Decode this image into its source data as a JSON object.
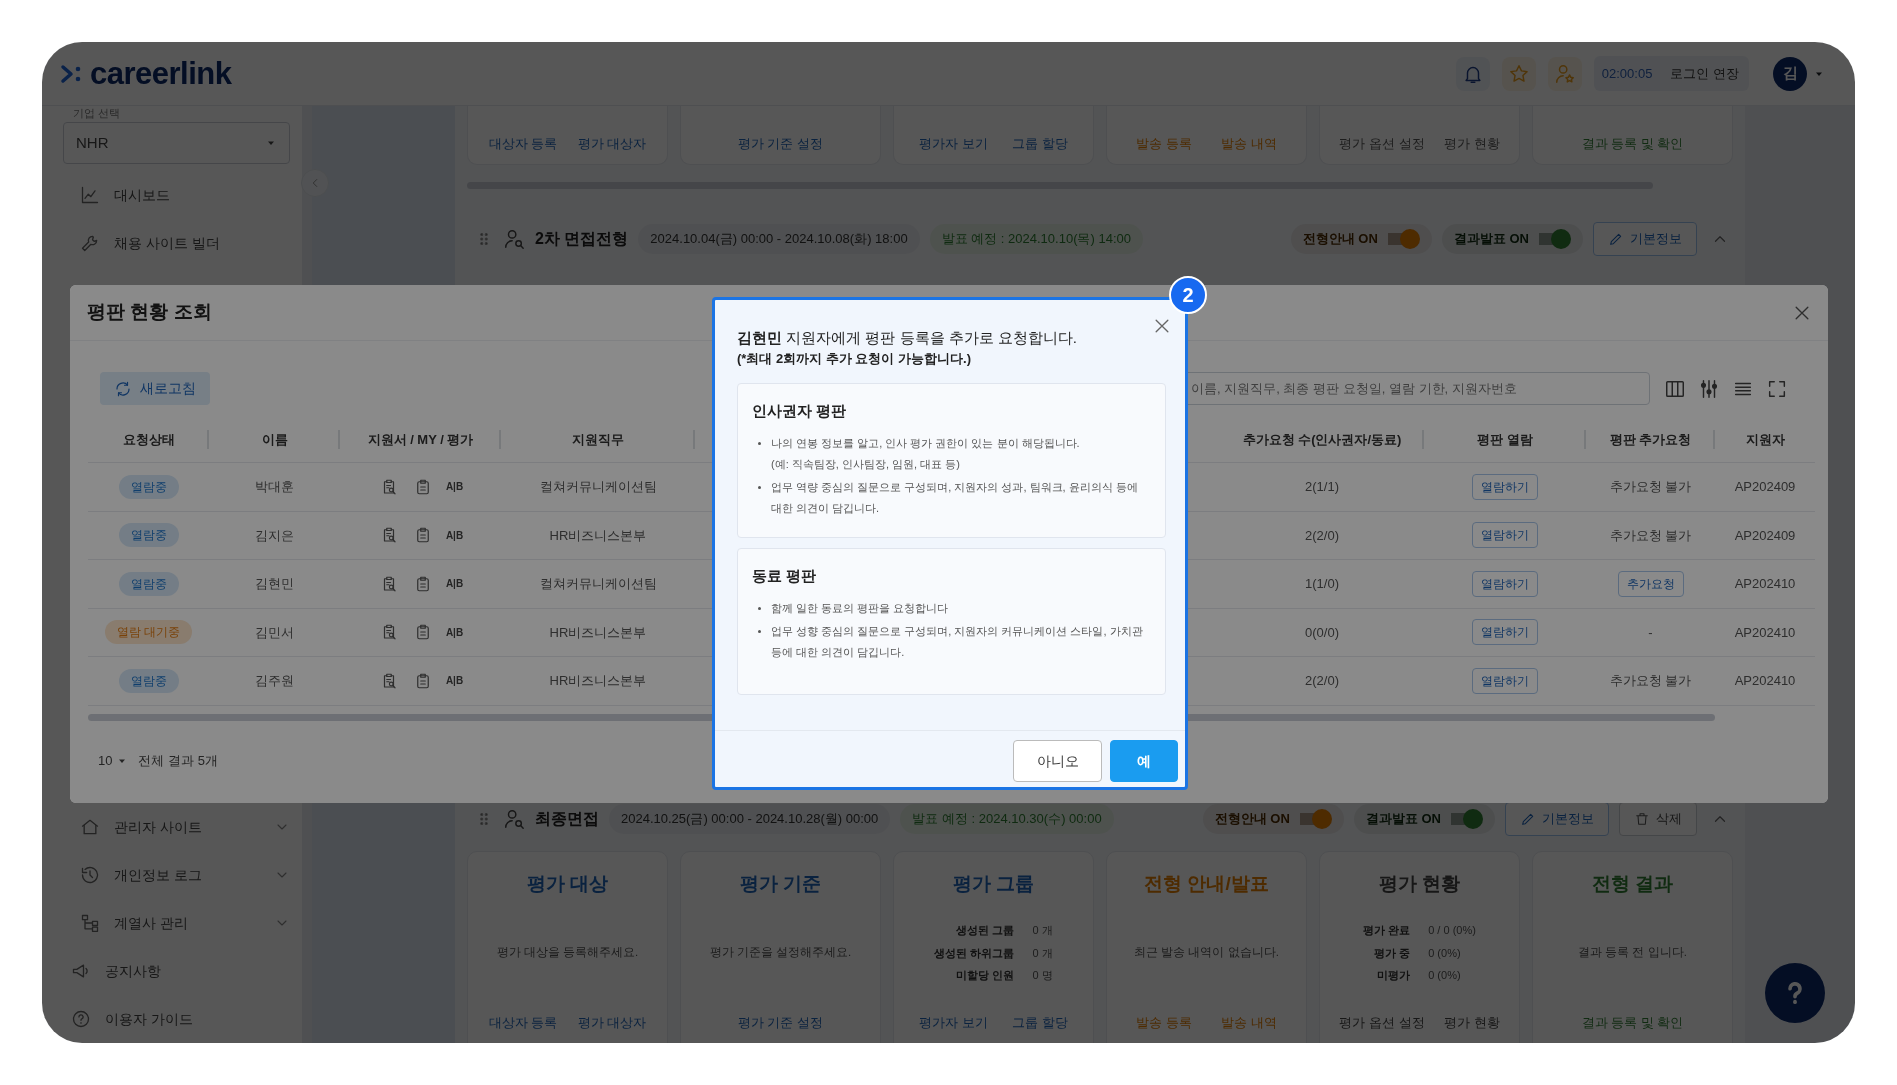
{
  "header": {
    "logo": "careerlink",
    "timer": "02:00:05",
    "extend_login": "로그인 연장",
    "avatar": "김"
  },
  "sidebar": {
    "company_label": "기업 선택",
    "company_value": "NHR",
    "top_items": [
      {
        "label": "대시보드",
        "kind": "link"
      },
      {
        "label": "채용 사이트 빌더",
        "kind": "link"
      }
    ],
    "bottom_items": [
      {
        "label": "관리자 사이트",
        "kind": "group",
        "expanded": false
      },
      {
        "label": "개인정보 로그",
        "kind": "group",
        "expanded": false
      },
      {
        "label": "계열사 관리",
        "kind": "group",
        "expanded": false
      },
      {
        "label": "공지사항",
        "kind": "link"
      },
      {
        "label": "이용자 가이드",
        "kind": "link"
      }
    ]
  },
  "top_strip": [
    {
      "color": "#0a223f",
      "links": [
        "대상자 등록",
        "평가 대상자"
      ]
    },
    {
      "color": "#0a223f",
      "links": [
        "평가 기준 설정"
      ]
    },
    {
      "color": "#0a223f",
      "links": [
        "평가자 보기",
        "그룹 할당"
      ]
    },
    {
      "color": "#4e2b00",
      "links": [
        "발송 등록",
        "발송 내역"
      ]
    },
    {
      "color": "#1d1d1d",
      "links": [
        "평가 옵션 설정",
        "평가 현황"
      ]
    },
    {
      "color": "#102b11",
      "links": [
        "결과 등록 및 확인"
      ]
    }
  ],
  "stages": [
    {
      "title": "2차 면접전형",
      "period": "2024.10.04(금) 00:00 - 2024.10.08(화) 18:00",
      "announce": "발표 예정 : 2024.10.10(목) 14:00",
      "expanded": true,
      "toggles": [
        {
          "label": "전형안내 ON",
          "on": true,
          "color": "#4e2b00"
        },
        {
          "label": "결과발표 ON",
          "on": true,
          "color": "#102b11"
        }
      ],
      "actions": [
        {
          "label": "기본정보",
          "kind": "edit"
        }
      ]
    },
    {
      "title": "최종면접",
      "period": "2024.10.25(금) 00:00 - 2024.10.28(월) 00:00",
      "announce": "발표 예정 : 2024.10.30(수) 00:00",
      "expanded": true,
      "toggles": [
        {
          "label": "전형안내 ON",
          "on": true,
          "color": "#4e2b00"
        },
        {
          "label": "결과발표 ON",
          "on": true,
          "color": "#102b11"
        }
      ],
      "actions": [
        {
          "label": "기본정보",
          "kind": "edit"
        },
        {
          "label": "삭제",
          "kind": "delete"
        }
      ],
      "cards": [
        {
          "title": "평가 대상",
          "color": "#0a223f",
          "kind": "message",
          "message": "평가 대상을 등록해주세요.",
          "links": [
            "대상자 등록",
            "평가 대상자"
          ]
        },
        {
          "title": "평가 기준",
          "color": "#0a223f",
          "kind": "message",
          "message": "평가 기준을 설정해주세요.",
          "links": [
            "평가 기준 설정"
          ]
        },
        {
          "title": "평가 그룹",
          "color": "#0a223f",
          "kind": "stats",
          "stats": [
            {
              "label": "생성된 그룹",
              "value": "0 개"
            },
            {
              "label": "생성된 하위그룹",
              "value": "0 개"
            },
            {
              "label": "미할당 인원",
              "value": "0 명"
            }
          ],
          "links": [
            "평가자 보기",
            "그룹 할당"
          ]
        },
        {
          "title": "전형 안내/발표",
          "color": "#4e2b00",
          "kind": "message",
          "message": "최근 발송 내역이 없습니다.",
          "links": [
            "발송 등록",
            "발송 내역"
          ]
        },
        {
          "title": "평가 현황",
          "color": "#171717",
          "kind": "stats",
          "stats": [
            {
              "label": "평가 완료",
              "value": "0 / 0 (0%)"
            },
            {
              "label": "평가 중",
              "value": "0 (0%)"
            },
            {
              "label": "미평가",
              "value": "0 (0%)"
            }
          ],
          "links": [
            "평가 옵션 설정",
            "평가 현황"
          ]
        },
        {
          "title": "전형 결과",
          "color": "#102b11",
          "kind": "message",
          "message": "결과 등록 전 입니다.",
          "links": [
            "결과 등록 및 확인"
          ]
        }
      ]
    }
  ],
  "panel": {
    "title": "평판 현황 조회",
    "refresh": "새로고침",
    "search_placeholder": "이름, 지원직무, 최종 평판 요청일, 열람 기한, 지원자번호",
    "columns": [
      "요청상태",
      "이름",
      "지원서 / MY / 평가",
      "지원직무",
      "추가요청 수(인사권자/동료)",
      "평판 열람",
      "평판 추가요청",
      "지원자"
    ],
    "rows": [
      {
        "status": {
          "label": "열람중",
          "kind": "viewing"
        },
        "name": "박대훈",
        "eval": "A|B",
        "team": "컬쳐커뮤니케이션팀",
        "count": "2(1/1)",
        "view": "열람하기",
        "extra": {
          "kind": "text",
          "label": "추가요청 불가"
        },
        "applicant_no": "AP202409"
      },
      {
        "status": {
          "label": "열람중",
          "kind": "viewing"
        },
        "name": "김지은",
        "eval": "A|B",
        "team": "HR비즈니스본부",
        "count": "2(2/0)",
        "view": "열람하기",
        "extra": {
          "kind": "text",
          "label": "추가요청 불가"
        },
        "applicant_no": "AP202409"
      },
      {
        "status": {
          "label": "열람중",
          "kind": "viewing"
        },
        "name": "김현민",
        "eval": "A|B",
        "team": "컬쳐커뮤니케이션팀",
        "count": "1(1/0)",
        "view": "열람하기",
        "extra": {
          "kind": "button",
          "label": "추가요청"
        },
        "applicant_no": "AP202410"
      },
      {
        "status": {
          "label": "열람 대기중",
          "kind": "waiting"
        },
        "name": "김민서",
        "eval": "A|B",
        "team": "HR비즈니스본부",
        "count": "0(0/0)",
        "view": "열람하기",
        "extra": {
          "kind": "text",
          "label": "-"
        },
        "applicant_no": "AP202410"
      },
      {
        "status": {
          "label": "열람중",
          "kind": "viewing"
        },
        "name": "김주원",
        "eval": "A|B",
        "team": "HR비즈니스본부",
        "count": "2(2/0)",
        "view": "열람하기",
        "extra": {
          "kind": "text",
          "label": "추가요청 불가"
        },
        "applicant_no": "AP202410"
      }
    ],
    "page_size": "10",
    "total": "전체 결과 5개"
  },
  "dialog": {
    "message": "**김현민** 지원자에게 평판 등록을 추가로 요청합니다.",
    "note": "**(*최대 2회**까지 추가 요청이 가능합니다.)",
    "sections": [
      {
        "title": "인사권자 평판",
        "bullets": [
          [
            "나의 연봉 정보를 알고, 인사 평가 권한이 있는 분이 해당됩니다.",
            "(예: 직속팀장, 인사팀장, 임원, 대표 등)"
          ],
          [
            "업무 역량 중심의 질문으로 구성되며, 지원자의 성과, 팀워크, 윤리의식 등에 대한 의견이 담깁니다."
          ]
        ]
      },
      {
        "title": "동료 평판",
        "bullets": [
          [
            "함께 일한 동료의 평판을 요청합니다"
          ],
          [
            "업무 성향 중심의 질문으로 구성되며, 지원자의 커뮤니케이션 스타일, 가치관 등에 대한 의견이 담깁니다."
          ]
        ]
      }
    ],
    "buttons": [
      {
        "label": "아니오",
        "kind": "secondary"
      },
      {
        "label": "예",
        "kind": "primary"
      }
    ],
    "step_badge": "2"
  }
}
